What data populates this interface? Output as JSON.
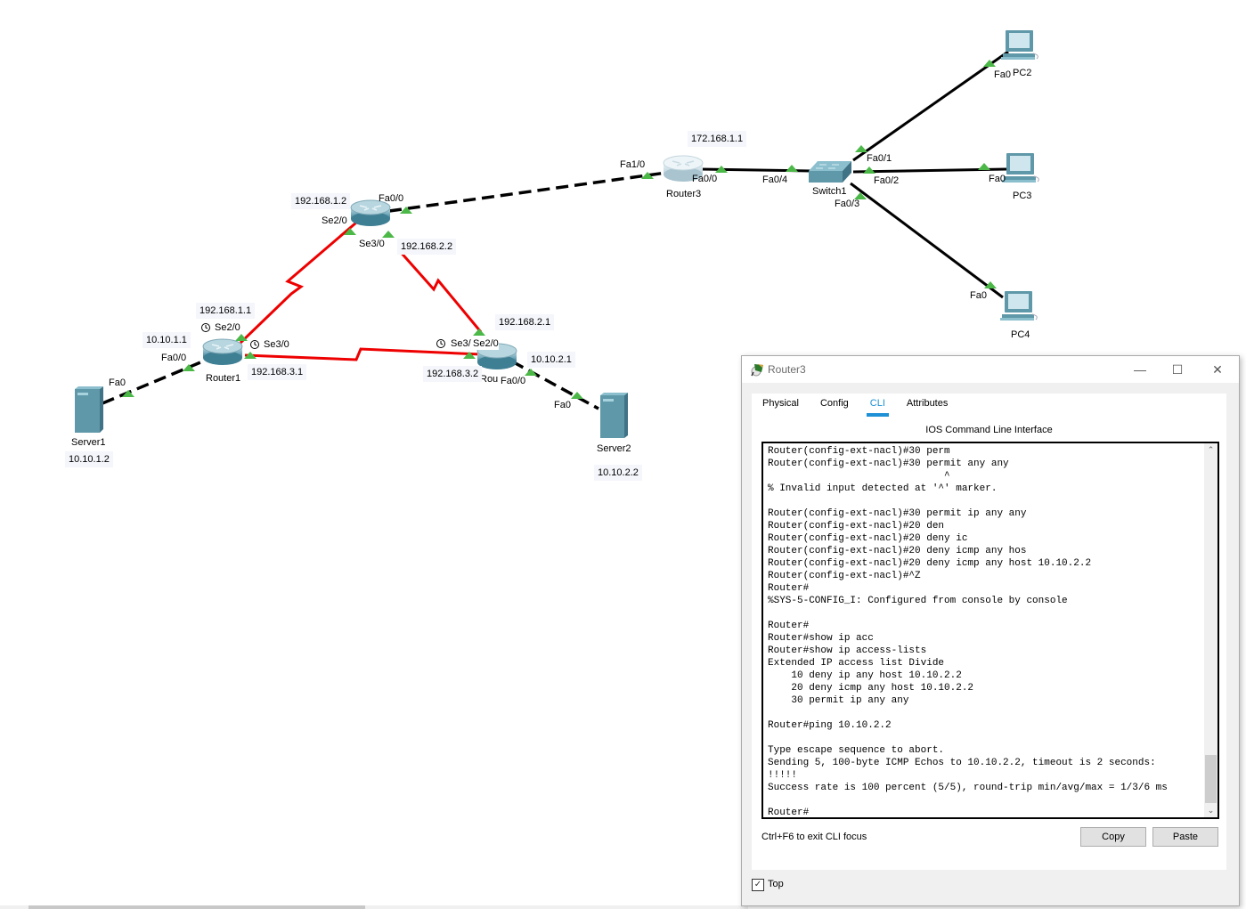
{
  "topology": {
    "devices": {
      "server1": {
        "name": "Server1",
        "ip": "10.10.1.2"
      },
      "server2": {
        "name": "Server2",
        "ip": "10.10.2.2"
      },
      "router1": {
        "name": "Router1"
      },
      "router2": {
        "name": "Rou"
      },
      "router3": {
        "name": "Router3"
      },
      "router_top": {
        "name": ""
      },
      "switch1": {
        "name": "Switch1"
      },
      "pc2": {
        "name": "PC2"
      },
      "pc3": {
        "name": "PC3"
      },
      "pc4": {
        "name": "PC4"
      }
    },
    "labels": {
      "r1_fa00_ip": "10.10.1.1",
      "r1_fa00": "Fa0/0",
      "r1_se20_ip": "192.168.1.1",
      "r1_se20": "Se2/0",
      "r1_se30": "Se3/0",
      "r1_se30_ip": "192.168.3.1",
      "s1_fa0": "Fa0",
      "rt_ip1": "192.168.1.2",
      "rt_fa00": "Fa0/0",
      "rt_se20": "Se2/0",
      "rt_se30": "Se3/0",
      "rt_se30_ip": "192.168.2.2",
      "r2_se20_ip": "192.168.2.1",
      "r2_se3": "Se3/",
      "r2_se20": "Se2/0",
      "r2_se3_ip": "192.168.3.2",
      "r2_fa00_ip": "10.10.2.1",
      "r2_fa00": "Fa0/0",
      "s2_fa0": "Fa0",
      "r3_fa10": "Fa1/0",
      "r3_ip": "172.168.1.1",
      "r3_fa00": "Fa0/0",
      "sw_fa04": "Fa0/4",
      "sw_fa01": "Fa0/1",
      "sw_fa02": "Fa0/2",
      "sw_fa03": "Fa0/3",
      "pc2_fa0": "Fa0",
      "pc3_fa0": "Fa0",
      "pc4_fa0": "Fa0"
    },
    "colors": {
      "serial_link": "#ee0000",
      "ethernet_link": "#000000",
      "port_up": "#4cb848"
    }
  },
  "dialog": {
    "title": "Router3",
    "controls": {
      "minimize": "—",
      "maximize": "☐",
      "close": "✕"
    },
    "tabs": [
      {
        "label": "Physical",
        "active": false
      },
      {
        "label": "Config",
        "active": false
      },
      {
        "label": "CLI",
        "active": true
      },
      {
        "label": "Attributes",
        "active": false
      }
    ],
    "heading": "IOS Command Line Interface",
    "console_lines": [
      "Router(config-ext-nacl)#30 perm",
      "Router(config-ext-nacl)#30 permit any any",
      "                              ^",
      "% Invalid input detected at '^' marker.",
      "",
      "Router(config-ext-nacl)#30 permit ip any any",
      "Router(config-ext-nacl)#20 den",
      "Router(config-ext-nacl)#20 deny ic",
      "Router(config-ext-nacl)#20 deny icmp any hos",
      "Router(config-ext-nacl)#20 deny icmp any host 10.10.2.2",
      "Router(config-ext-nacl)#^Z",
      "Router#",
      "%SYS-5-CONFIG_I: Configured from console by console",
      "",
      "Router#",
      "Router#show ip acc",
      "Router#show ip access-lists",
      "Extended IP access list Divide",
      "    10 deny ip any host 10.10.2.2",
      "    20 deny icmp any host 10.10.2.2",
      "    30 permit ip any any",
      "",
      "Router#ping 10.10.2.2",
      "",
      "Type escape sequence to abort.",
      "Sending 5, 100-byte ICMP Echos to 10.10.2.2, timeout is 2 seconds:",
      "!!!!!",
      "Success rate is 100 percent (5/5), round-trip min/avg/max = 1/3/6 ms",
      "",
      "Router#"
    ],
    "hint": "Ctrl+F6 to exit CLI focus",
    "copy_label": "Copy",
    "paste_label": "Paste",
    "top_checkbox": {
      "label": "Top",
      "checked": true
    }
  }
}
